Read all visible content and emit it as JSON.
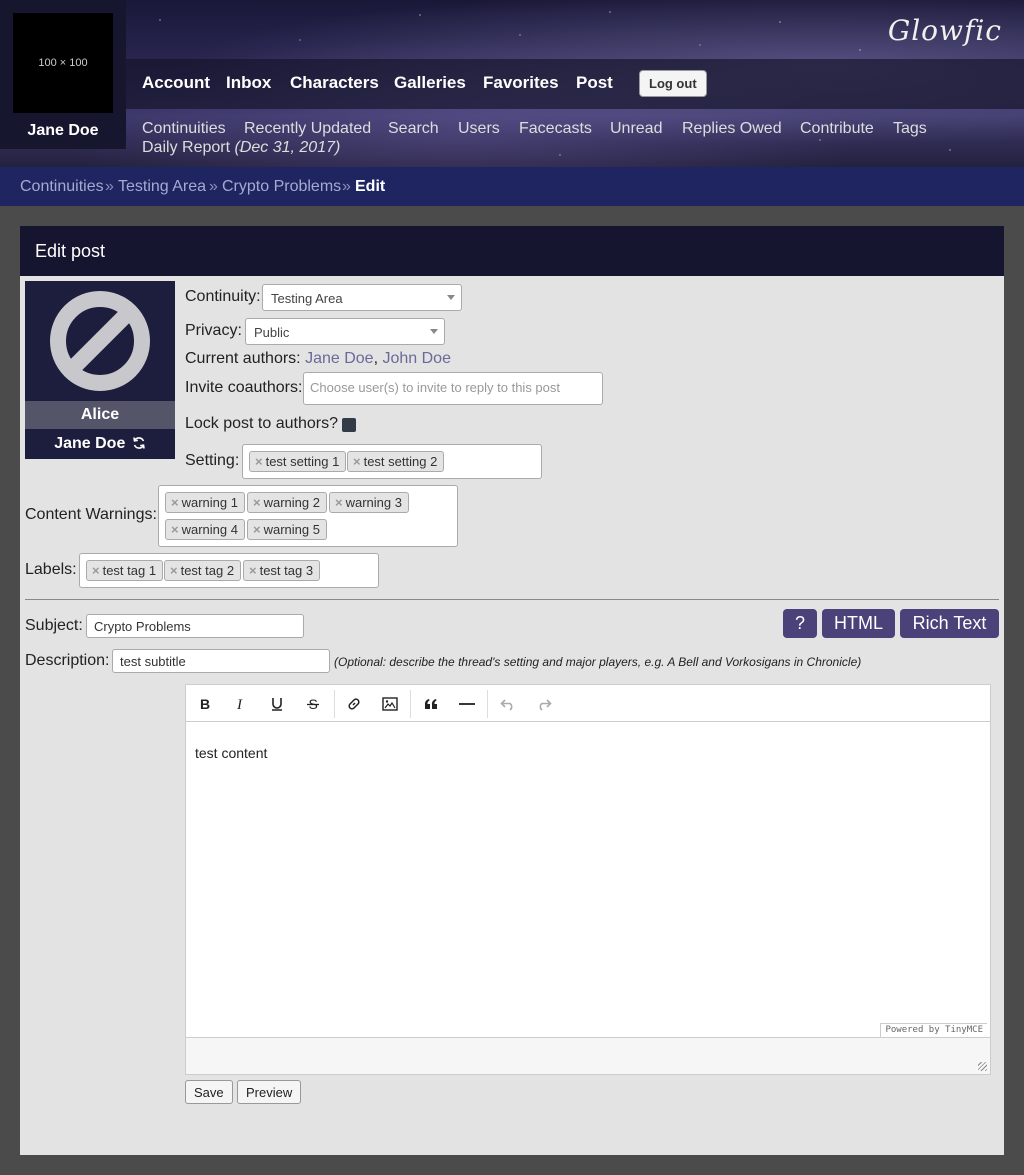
{
  "header": {
    "avatar_placeholder": "100 × 100",
    "user_name": "Jane Doe",
    "logo_text": "Glowfic",
    "nav": [
      "Account",
      "Inbox",
      "Characters",
      "Galleries",
      "Favorites",
      "Post"
    ],
    "logout_label": "Log out",
    "subnav": [
      "Continuities",
      "Recently Updated",
      "Search",
      "Users",
      "Facecasts",
      "Unread",
      "Replies Owed",
      "Contribute",
      "Tags"
    ],
    "daily_report": "Daily Report",
    "daily_report_date": "(Dec 31, 2017)"
  },
  "breadcrumb": {
    "items": [
      "Continuities",
      "Testing Area",
      "Crypto Problems"
    ],
    "separator": "»",
    "current": "Edit"
  },
  "panel": {
    "title": "Edit post"
  },
  "character": {
    "name": "Alice",
    "user": "Jane Doe",
    "icon": "no-icon-placeholder",
    "switch_icon": "refresh-icon"
  },
  "form": {
    "continuity_label": "Continuity:",
    "continuity_value": "Testing Area",
    "privacy_label": "Privacy:",
    "privacy_value": "Public",
    "authors_label": "Current authors:",
    "authors": [
      "Jane Doe",
      "John Doe"
    ],
    "authors_sep": ",",
    "invite_label": "Invite coauthors:",
    "invite_placeholder": "Choose user(s) to invite to reply to this post",
    "lock_label": "Lock post to authors?",
    "setting_label": "Setting:",
    "settings": [
      "test setting 1",
      "test setting 2"
    ],
    "warnings_label": "Content Warnings:",
    "warnings": [
      "warning 1",
      "warning 2",
      "warning 3",
      "warning 4",
      "warning 5"
    ],
    "labels_label": "Labels:",
    "labels": [
      "test tag 1",
      "test tag 2",
      "test tag 3"
    ],
    "subject_label": "Subject:",
    "subject_value": "Crypto Problems",
    "description_label": "Description:",
    "description_value": "test subtitle",
    "description_hint": "(Optional: describe the thread's setting and major players, e.g. A Bell and Vorkosigans in Chronicle)",
    "help_btn": "?",
    "html_btn": "HTML",
    "rich_btn": "Rich Text",
    "tag_remove": "×"
  },
  "editor": {
    "content": "test content",
    "powered_by": "Powered by TinyMCE",
    "tools": [
      "bold-icon",
      "italic-icon",
      "underline-icon",
      "strikethrough-icon",
      "link-icon",
      "image-icon",
      "blockquote-icon",
      "horizontal-rule-icon",
      "undo-icon",
      "redo-icon"
    ]
  },
  "actions": {
    "save_label": "Save",
    "preview_label": "Preview"
  },
  "colors": {
    "nav_bg": "#15152f",
    "breadcrumb_bg": "#1e2560",
    "panel_bg": "#e3e3e3",
    "accent_button": "#4a4278",
    "author_link": "#6a6a9a"
  }
}
